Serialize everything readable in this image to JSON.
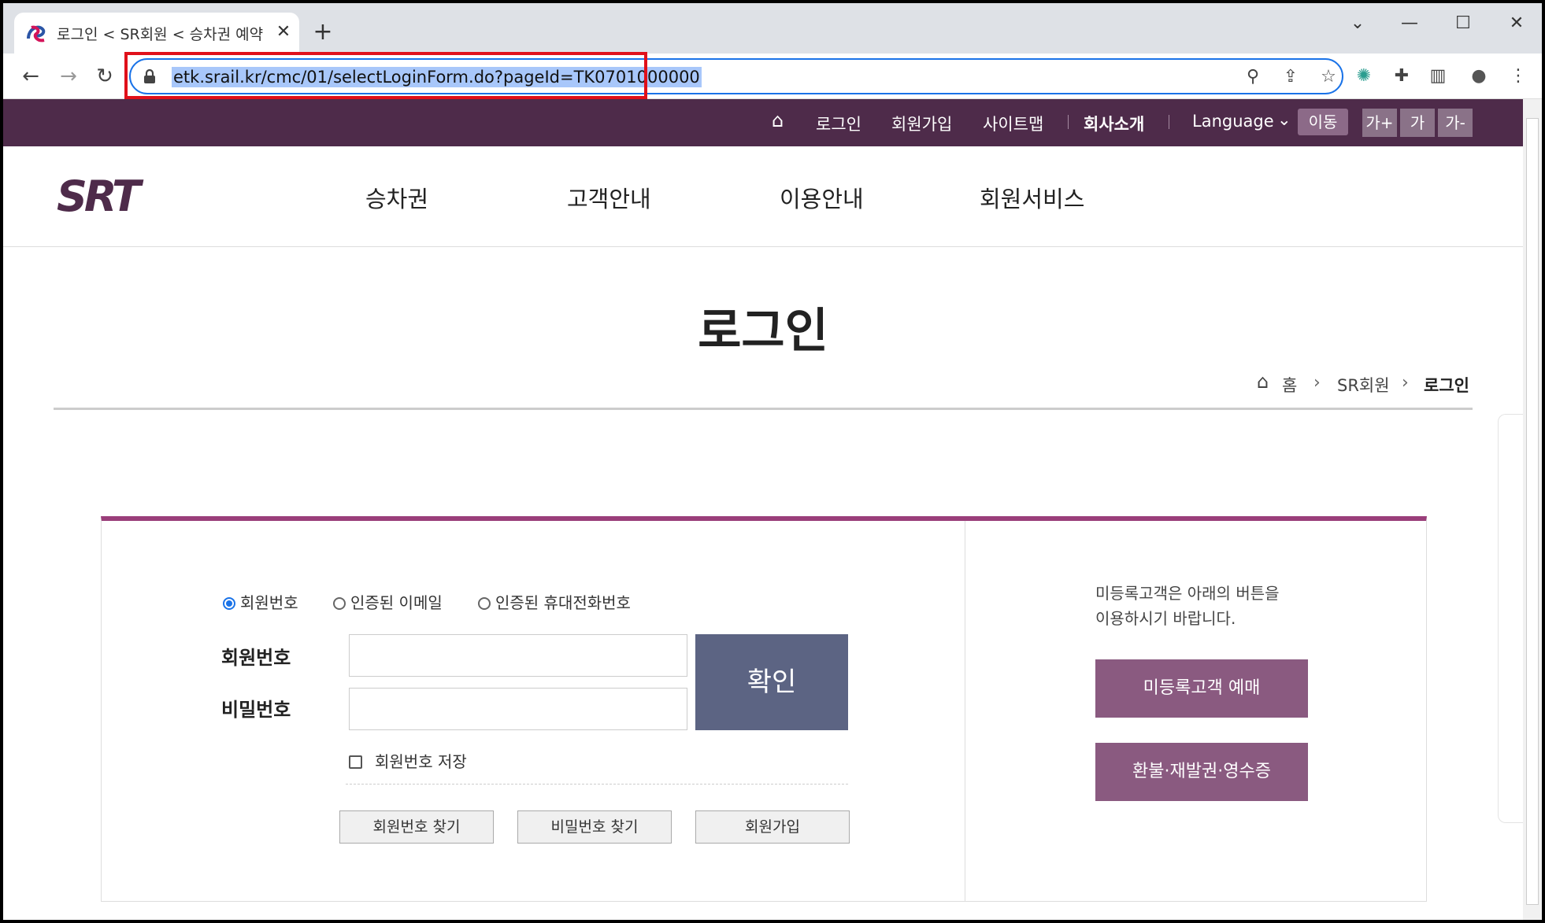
{
  "browser": {
    "tab_title": "로그인 < SR회원 < 승차권 예약",
    "tab_close": "✕",
    "new_tab": "+",
    "url": "etk.srail.kr/cmc/01/selectLoginForm.do?pageId=TK0701000000",
    "window_controls": {
      "dropdown": "⌄",
      "minimize": "—",
      "maximize": "☐",
      "close": "✕"
    },
    "nav": {
      "back": "←",
      "forward": "→",
      "reload": "↻"
    },
    "omnibox_icons": {
      "search": "⚲",
      "share": "⇪",
      "bookmark": "☆"
    },
    "toolbar_icons": {
      "extension_a": "✺",
      "extensions": "✚",
      "sidepanel": "▥",
      "profile": "●",
      "menu": "⋮"
    },
    "accent": "#1a73e8"
  },
  "utility": {
    "home_icon": "⌂",
    "login": "로그인",
    "signup": "회원가입",
    "sitemap": "사이트맵",
    "company": "회사소개",
    "language": "Language",
    "language_arrow": "⌄",
    "move": "이동",
    "font_up": "가+",
    "font_normal": "가",
    "font_down": "가-",
    "bg_color": "#4e2b4a"
  },
  "gnb": {
    "logo_text": "SRT",
    "items": [
      "승차권",
      "고객안내",
      "이용안내",
      "회원서비스"
    ]
  },
  "page": {
    "title": "로그인",
    "breadcrumb": {
      "home_icon": "⌂",
      "home": "홈",
      "level1": "SR회원",
      "current": "로그인",
      "sep": "›"
    }
  },
  "login": {
    "radio_options": [
      "회원번호",
      "인증된 이메일",
      "인증된 휴대전화번호"
    ],
    "selected_radio": "회원번호",
    "member_no_label": "회원번호",
    "member_no_value": "",
    "password_label": "비밀번호",
    "password_value": "",
    "confirm": "확인",
    "save_member_no": "회원번호 저장",
    "find_member_no": "회원번호 찾기",
    "find_password": "비밀번호 찾기",
    "join": "회원가입",
    "accent": "#9a3e7a",
    "confirm_color": "#5c6483"
  },
  "guest": {
    "guide_line1": "미등록고객은 아래의 버튼을",
    "guide_line2": "이용하시기 바랍니다.",
    "guest_booking": "미등록고객 예매",
    "refund": "환불·재발권·영수증",
    "button_color": "#8a5a80"
  }
}
